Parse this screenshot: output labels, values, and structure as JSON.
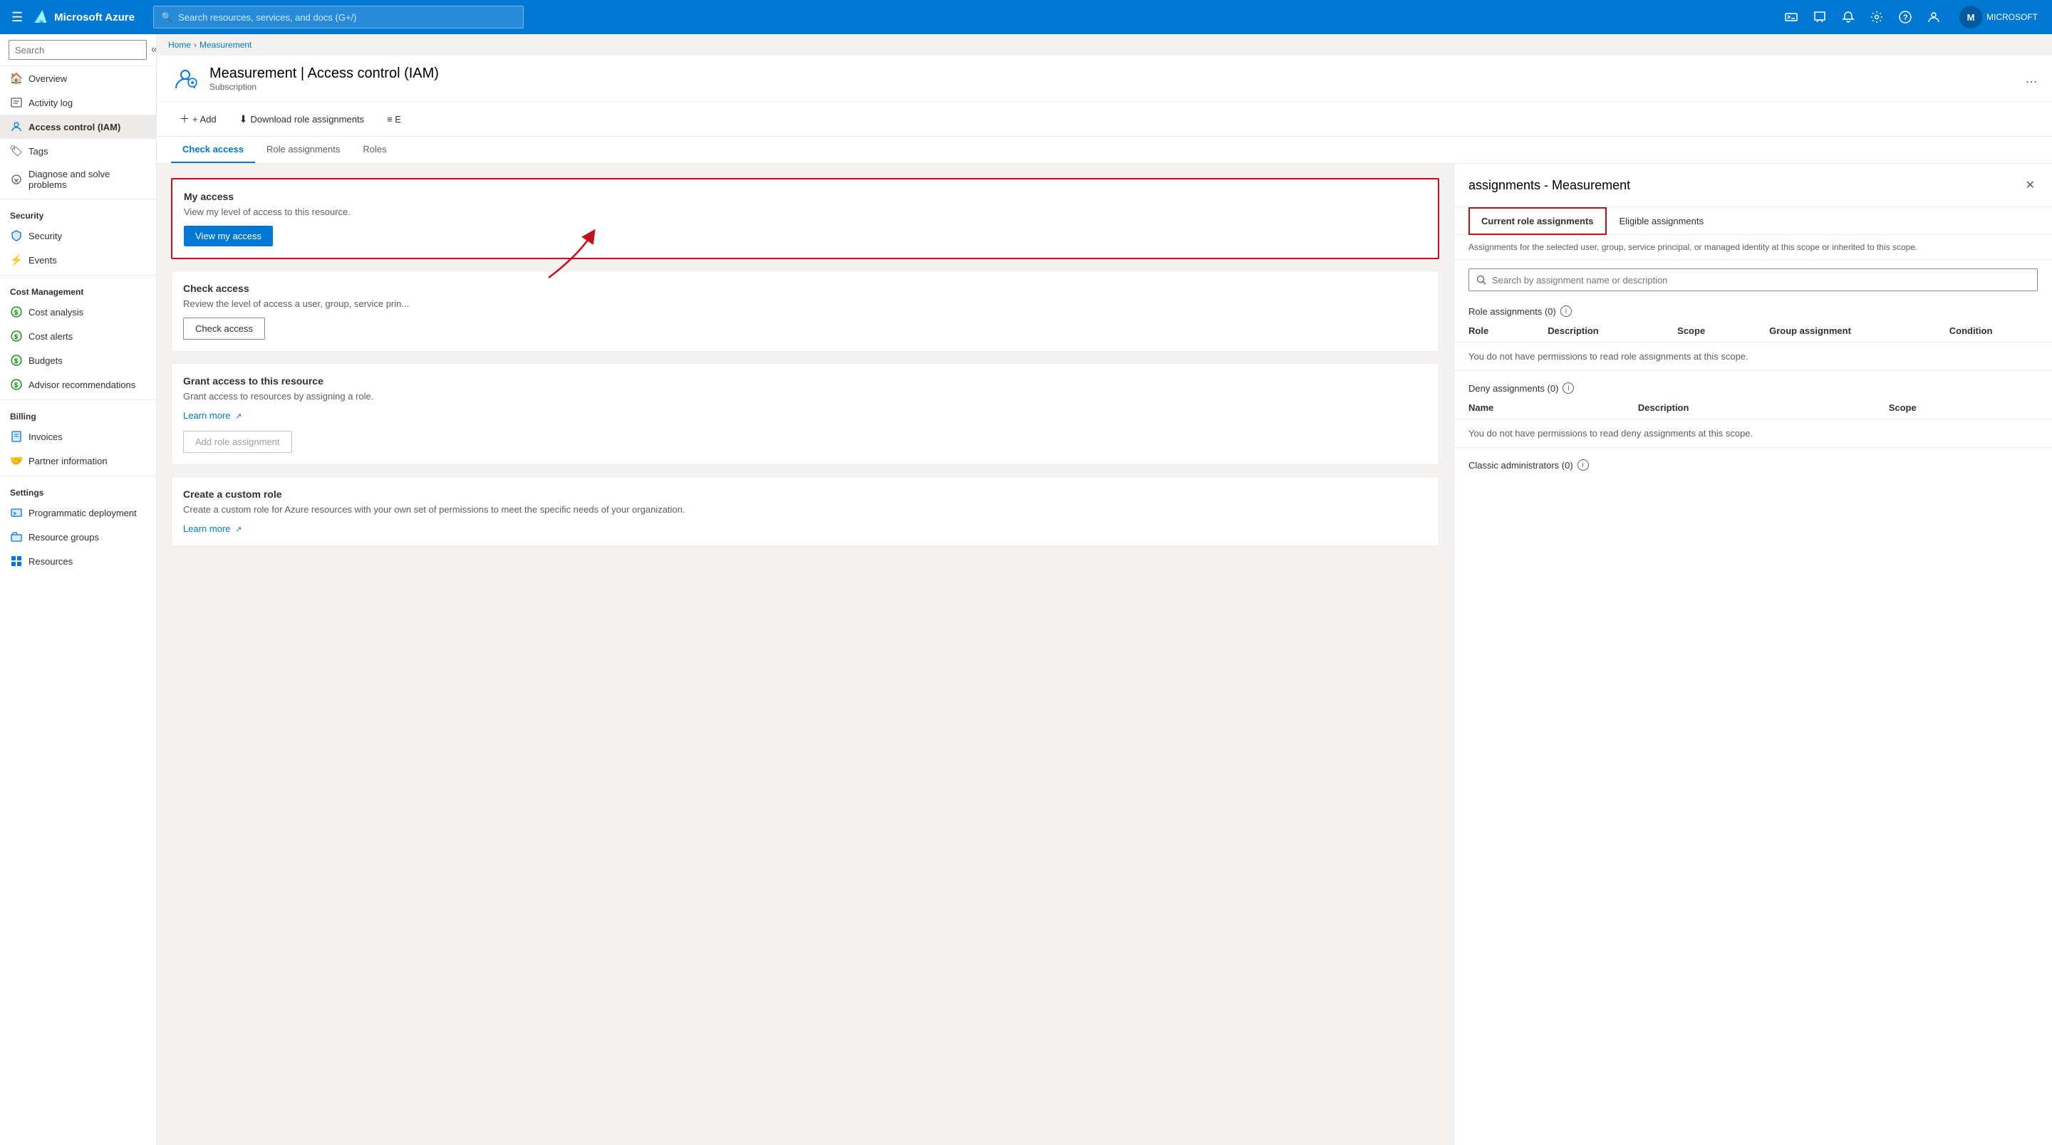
{
  "topnav": {
    "hamburger": "☰",
    "logo": "Microsoft Azure",
    "search_placeholder": "Search resources, services, and docs (G+/)",
    "icons": [
      {
        "name": "cloud-shell-icon",
        "symbol": "⬛"
      },
      {
        "name": "feedback-icon",
        "symbol": "☁"
      },
      {
        "name": "notifications-icon",
        "symbol": "🔔"
      },
      {
        "name": "settings-icon",
        "symbol": "⚙"
      },
      {
        "name": "help-icon",
        "symbol": "?"
      },
      {
        "name": "profile-icon",
        "symbol": "👤"
      }
    ],
    "username": "MICROSOFT",
    "avatar_initials": "M"
  },
  "breadcrumb": {
    "home": "Home",
    "separator": ">",
    "current": "Measurement"
  },
  "sidebar": {
    "search_placeholder": "Search",
    "items": [
      {
        "id": "overview",
        "label": "Overview",
        "icon": "🏠"
      },
      {
        "id": "activity-log",
        "label": "Activity log",
        "icon": "📋"
      },
      {
        "id": "access-control",
        "label": "Access control (IAM)",
        "icon": "👤",
        "active": true
      },
      {
        "id": "tags",
        "label": "Tags",
        "icon": "🏷"
      },
      {
        "id": "diagnose",
        "label": "Diagnose and solve problems",
        "icon": "🔧"
      }
    ],
    "sections": [
      {
        "title": "Security",
        "items": [
          {
            "id": "security",
            "label": "Security",
            "icon": "🛡"
          },
          {
            "id": "events",
            "label": "Events",
            "icon": "⚡"
          }
        ]
      },
      {
        "title": "Cost Management",
        "items": [
          {
            "id": "cost-analysis",
            "label": "Cost analysis",
            "icon": "💰"
          },
          {
            "id": "cost-alerts",
            "label": "Cost alerts",
            "icon": "💰"
          },
          {
            "id": "budgets",
            "label": "Budgets",
            "icon": "💰"
          },
          {
            "id": "advisor",
            "label": "Advisor recommendations",
            "icon": "💰"
          }
        ]
      },
      {
        "title": "Billing",
        "items": [
          {
            "id": "invoices",
            "label": "Invoices",
            "icon": "📄"
          },
          {
            "id": "partner",
            "label": "Partner information",
            "icon": "🤝"
          }
        ]
      },
      {
        "title": "Settings",
        "items": [
          {
            "id": "programmatic",
            "label": "Programmatic deployment",
            "icon": "📦"
          },
          {
            "id": "resource-groups",
            "label": "Resource groups",
            "icon": "📂"
          },
          {
            "id": "resources",
            "label": "Resources",
            "icon": "📊"
          }
        ]
      }
    ]
  },
  "header": {
    "title": "Measurement | Access control (IAM)",
    "subtitle": "Subscription",
    "more": "…"
  },
  "toolbar": {
    "add": "+ Add",
    "download": "Download role assignments",
    "edit": "≡ E"
  },
  "tabs": {
    "items": [
      {
        "id": "check-access",
        "label": "Check access",
        "active": true
      },
      {
        "id": "role-assignments",
        "label": "Role assignments"
      },
      {
        "id": "roles",
        "label": "Roles"
      }
    ]
  },
  "my_access_card": {
    "title": "My access",
    "desc": "View my level of access to this resource.",
    "btn_label": "View my access"
  },
  "check_access_card": {
    "title": "Check access",
    "desc": "Review the level of access a user, group, service prin...",
    "btn_label": "Check access"
  },
  "grant_access_card": {
    "title": "Grant access to this resource",
    "desc": "Grant access to resources by assigning a role.",
    "learn_more": "Learn more",
    "btn_label": "Add role assignment"
  },
  "custom_role_card": {
    "title": "Create a custom role",
    "desc": "Create a custom role for Azure resources with your own set of permissions to meet the specific needs of your organization.",
    "learn_more": "Learn more"
  },
  "side_panel": {
    "title": "assignments - Measurement",
    "close_btn": "✕",
    "tabs": [
      {
        "id": "current",
        "label": "Current role assignments",
        "active": true
      },
      {
        "id": "eligible",
        "label": "Eligible assignments"
      }
    ],
    "description": "Assignments for the selected user, group, service principal, or managed identity at this scope or inherited to this scope.",
    "search_placeholder": "Search by assignment name or description",
    "role_assignments_section": {
      "title": "Role assignments (0)",
      "info": "i",
      "columns": [
        "Role",
        "Description",
        "Scope",
        "Group assignment",
        "Condition"
      ],
      "empty_msg": "You do not have permissions to read role assignments at this scope."
    },
    "deny_assignments_section": {
      "title": "Deny assignments (0)",
      "info": "i",
      "columns": [
        "Name",
        "Description",
        "Scope"
      ],
      "empty_msg": "You do not have permissions to read deny assignments at this scope."
    },
    "classic_admins_section": {
      "title": "Classic administrators (0)",
      "info": "i"
    }
  }
}
